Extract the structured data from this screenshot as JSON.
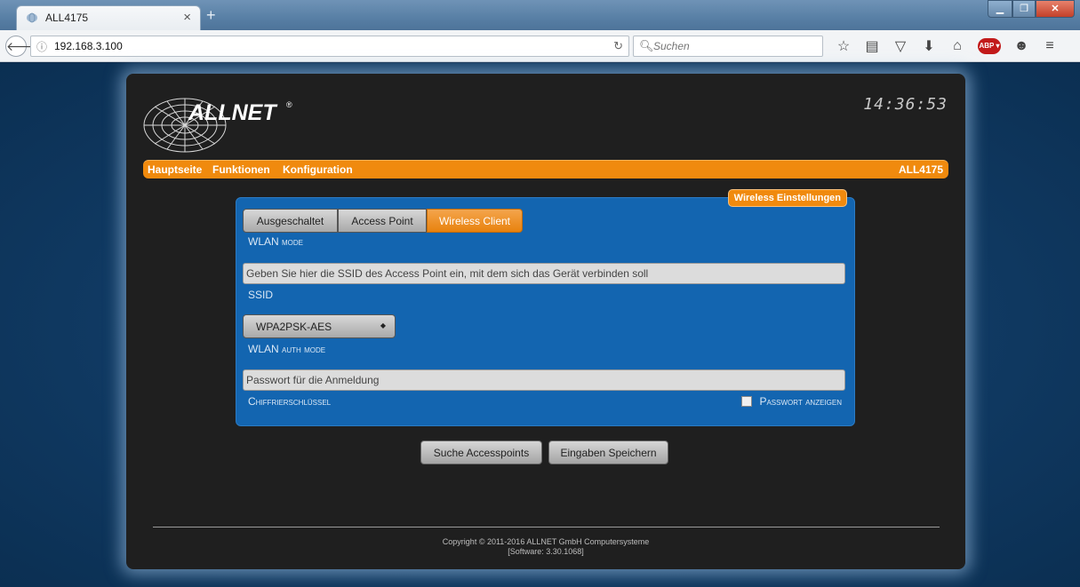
{
  "browser": {
    "tab_title": "ALL4175",
    "tab_close": "×",
    "new_tab": "+",
    "url": "192.168.3.100",
    "search_placeholder": "Suchen"
  },
  "header": {
    "brand": "ALLNET",
    "registered": "®",
    "clock": "14:36:53"
  },
  "menu": {
    "items": [
      "Hauptseite",
      "Funktionen",
      "Konfiguration"
    ],
    "model": "ALL4175"
  },
  "panel": {
    "title": "Wireless Einstellungen",
    "wlan_mode": {
      "options": [
        "Ausgeschaltet",
        "Access Point",
        "Wireless Client"
      ],
      "selected": "Wireless Client",
      "label": "WLAN mode"
    },
    "ssid": {
      "placeholder": "Geben Sie hier die SSID des Access Point ein, mit dem sich das Gerät verbinden soll",
      "label": "SSID"
    },
    "auth": {
      "value": "WPA2PSK-AES",
      "label": "WLAN auth mode"
    },
    "password": {
      "placeholder": "Passwort für die Anmeldung",
      "label": "Chiffrierschlüssel",
      "show_label": "Passwort anzeigen",
      "show_checked": false
    }
  },
  "actions": {
    "search": "Suche Accesspoints",
    "save": "Eingaben Speichern"
  },
  "footer": {
    "copyright": "Copyright © 2011-2016 ALLNET GmbH Computersysteme",
    "software": "[Software: 3.30.1068]"
  }
}
